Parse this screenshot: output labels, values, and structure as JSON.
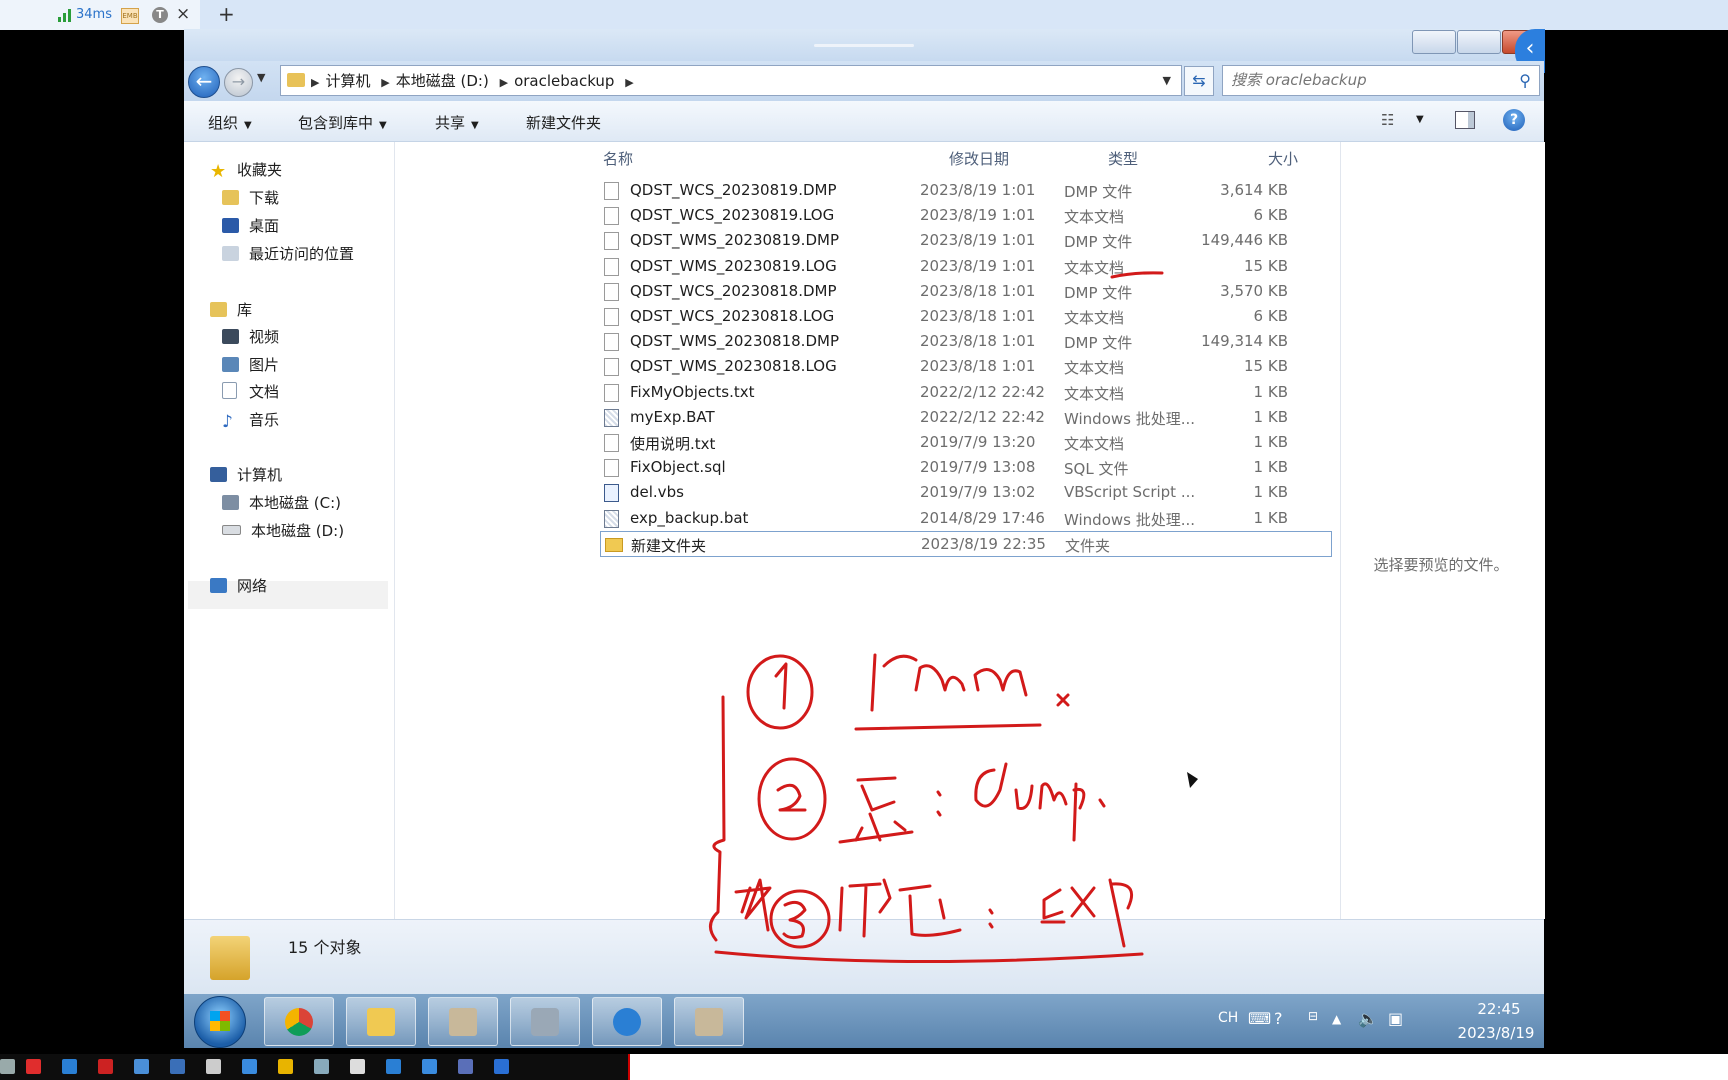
{
  "topbar": {
    "latency": "34ms",
    "badge": "EMB",
    "avatar_letter": "T",
    "close": "×",
    "new_tab": "+"
  },
  "window": {
    "side_pull": "‹"
  },
  "address": {
    "crumbs": [
      "计算机",
      "本地磁盘 (D:)",
      "oraclebackup"
    ],
    "search_placeholder": "搜索 oraclebackup"
  },
  "toolbar": {
    "organize": "组织",
    "include_library": "包含到库中",
    "share": "共享",
    "new_folder": "新建文件夹",
    "help": "?"
  },
  "nav": {
    "favorites": "收藏夹",
    "favorites_items": [
      "下载",
      "桌面",
      "最近访问的位置"
    ],
    "libraries": "库",
    "library_items": [
      "视频",
      "图片",
      "文档",
      "音乐"
    ],
    "computer": "计算机",
    "computer_items": [
      "本地磁盘 (C:)",
      "本地磁盘 (D:)"
    ],
    "network": "网络"
  },
  "columns": {
    "name": "名称",
    "modified": "修改日期",
    "type": "类型",
    "size": "大小"
  },
  "files": [
    {
      "name": "QDST_WCS_20230819.DMP",
      "date": "2023/8/19 1:01",
      "type": "DMP 文件",
      "size": "3,614 KB",
      "icon": "file-icon"
    },
    {
      "name": "QDST_WCS_20230819.LOG",
      "date": "2023/8/19 1:01",
      "type": "文本文档",
      "size": "6 KB",
      "icon": "file-icon"
    },
    {
      "name": "QDST_WMS_20230819.DMP",
      "date": "2023/8/19 1:01",
      "type": "DMP 文件",
      "size": "149,446 KB",
      "icon": "file-icon"
    },
    {
      "name": "QDST_WMS_20230819.LOG",
      "date": "2023/8/19 1:01",
      "type": "文本文档",
      "size": "15 KB",
      "icon": "file-icon"
    },
    {
      "name": "QDST_WCS_20230818.DMP",
      "date": "2023/8/18 1:01",
      "type": "DMP 文件",
      "size": "3,570 KB",
      "icon": "file-icon"
    },
    {
      "name": "QDST_WCS_20230818.LOG",
      "date": "2023/8/18 1:01",
      "type": "文本文档",
      "size": "6 KB",
      "icon": "file-icon"
    },
    {
      "name": "QDST_WMS_20230818.DMP",
      "date": "2023/8/18 1:01",
      "type": "DMP 文件",
      "size": "149,314 KB",
      "icon": "file-icon"
    },
    {
      "name": "QDST_WMS_20230818.LOG",
      "date": "2023/8/18 1:01",
      "type": "文本文档",
      "size": "15 KB",
      "icon": "file-icon"
    },
    {
      "name": "FixMyObjects.txt",
      "date": "2022/2/12 22:42",
      "type": "文本文档",
      "size": "1 KB",
      "icon": "file-icon"
    },
    {
      "name": "myExp.BAT",
      "date": "2022/2/12 22:42",
      "type": "Windows 批处理...",
      "size": "1 KB",
      "icon": "batch-file-icon"
    },
    {
      "name": "使用说明.txt",
      "date": "2019/7/9 13:20",
      "type": "文本文档",
      "size": "1 KB",
      "icon": "file-icon"
    },
    {
      "name": "FixObject.sql",
      "date": "2019/7/9 13:08",
      "type": "SQL 文件",
      "size": "1 KB",
      "icon": "file-icon"
    },
    {
      "name": "del.vbs",
      "date": "2019/7/9 13:02",
      "type": "VBScript Script ...",
      "size": "1 KB",
      "icon": "vbscript-file-icon"
    },
    {
      "name": "exp_backup.bat",
      "date": "2014/8/29 17:46",
      "type": "Windows 批处理...",
      "size": "1 KB",
      "icon": "batch-file-icon"
    },
    {
      "name": "新建文件夹",
      "date": "2023/8/19 22:35",
      "type": "文件夹",
      "size": "",
      "icon": "folder-icon"
    }
  ],
  "preview": {
    "empty_text": "选择要预览的文件。"
  },
  "status": {
    "count": "15 个对象"
  },
  "taskbar": {
    "lang": "CH",
    "time": "22:45",
    "date": "2023/8/19"
  },
  "colors": {
    "accent": "#2c7fde",
    "ink": "#d21a1a",
    "taskbar": "#6a93bd"
  }
}
